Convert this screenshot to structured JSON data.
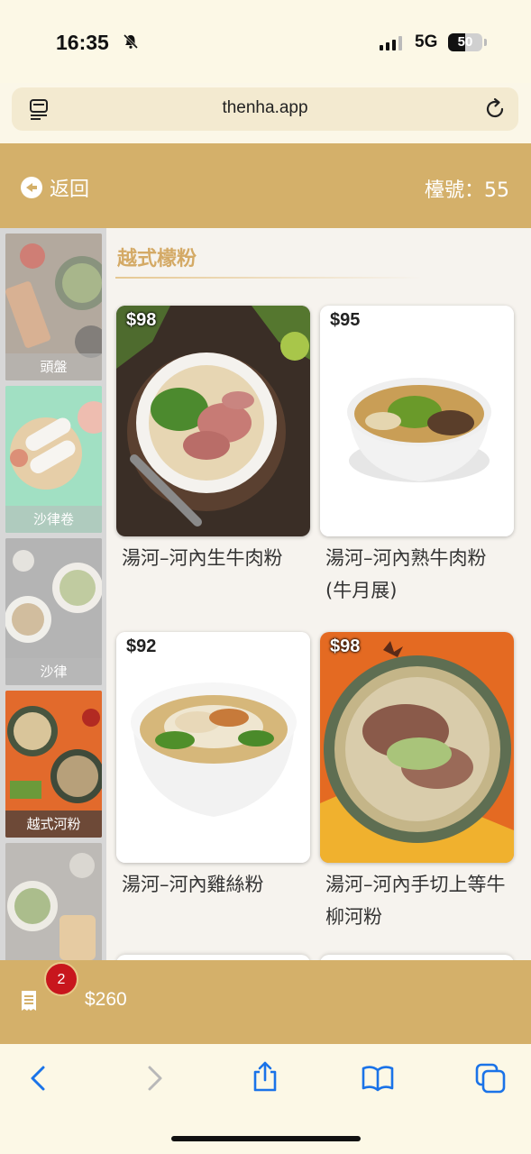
{
  "status_bar": {
    "time": "16:35",
    "network": "5G",
    "battery": "50"
  },
  "browser": {
    "url": "thenha.app"
  },
  "header": {
    "back_label": "返回",
    "table_label": "檯號：55"
  },
  "sidebar": {
    "categories": [
      {
        "label": "頭盤"
      },
      {
        "label": "沙律卷"
      },
      {
        "label": "沙律"
      },
      {
        "label": "越式河粉",
        "active": true
      },
      {
        "label": ""
      }
    ]
  },
  "section": {
    "title": "越式檬粉"
  },
  "menu_items": [
    {
      "price": "$98",
      "name": "湯河–河內生牛肉粉"
    },
    {
      "price": "$95",
      "name": "湯河–河內熟牛肉粉(牛月展)"
    },
    {
      "price": "$92",
      "name": "湯河–河內雞絲粉"
    },
    {
      "price": "$98",
      "name": "湯河–河內手切上等牛柳河粉"
    }
  ],
  "cart": {
    "count": "2",
    "total": "$260"
  },
  "colors": {
    "brand_gold": "#d4b06a",
    "badge_red": "#c8161d",
    "section_title": "#d4aa66"
  }
}
